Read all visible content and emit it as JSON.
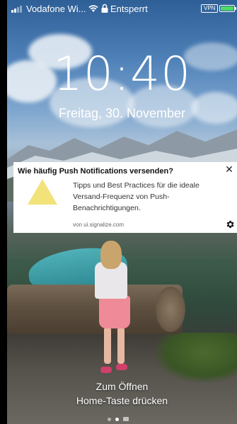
{
  "status_bar": {
    "carrier": "Vodafone Wi...",
    "lock_state": "Entsperrt",
    "vpn_label": "VPN",
    "battery_level": 1.0,
    "signal_bars": 2
  },
  "lockscreen": {
    "time": "10:40",
    "date": "Freitag, 30. November"
  },
  "notification": {
    "title": "Wie häufig Push Notifications versenden?",
    "body": "Tipps und Best Practices für die ideale Versand-Frequenz von Push-Benachrichtigungen.",
    "source": "von ui.signalize.com",
    "close_glyph": "✕",
    "thumbnail_color": "#f2e27a",
    "icons": [
      "close-icon",
      "gear-icon",
      "triangle-thumbnail"
    ]
  },
  "unlock_hint": {
    "line1": "Zum Öffnen",
    "line2": "Home-Taste drücken"
  },
  "page_indicator": {
    "count": 3,
    "active_index": 1
  },
  "colors": {
    "battery": "#4cd964",
    "notification_bg": "#ffffff"
  }
}
